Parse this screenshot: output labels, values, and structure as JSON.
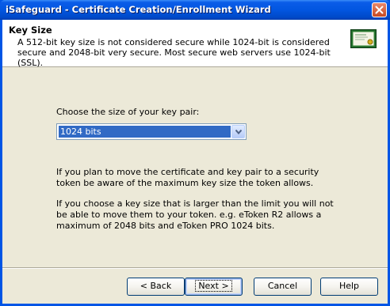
{
  "window": {
    "title": "iSafeguard - Certificate Creation/Enrollment Wizard"
  },
  "header": {
    "title": "Key Size",
    "description": "A 512-bit key size is not considered secure while 1024-bit is considered secure and 2048-bit very secure. Most secure web servers use 1024-bit (SSL).",
    "icon": "certificate-icon"
  },
  "form": {
    "choose_label": "Choose the size of your key pair:",
    "key_size_selected": "1024 bits"
  },
  "info": {
    "paragraph1": "If you plan to move the certificate and key pair to a security token be aware of the maximum key size the token allows.",
    "paragraph2": "If you choose a key size that is larger than the limit you will not be able to move them to your token. e.g. eToken R2 allows a maximum of 2048 bits and eToken PRO 1024 bits."
  },
  "buttons": {
    "back": "< Back",
    "next": "Next >",
    "cancel": "Cancel",
    "help": "Help"
  },
  "colors": {
    "titlebar": "#0256e0",
    "dialog_face": "#ece9d8",
    "selection": "#316ac5"
  }
}
